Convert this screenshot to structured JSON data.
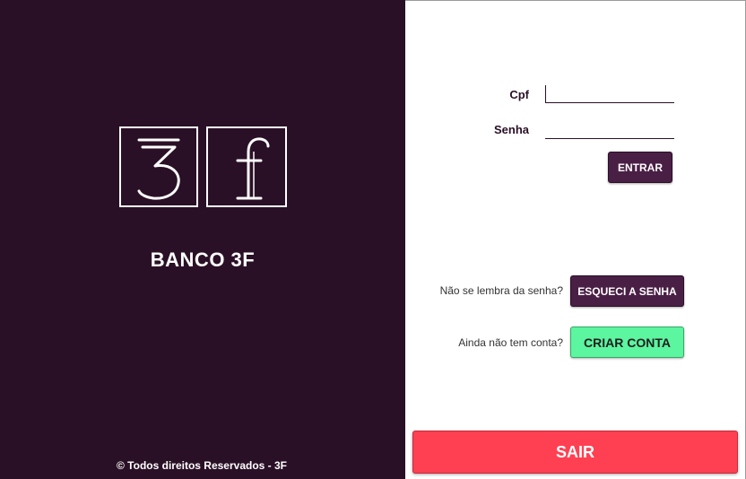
{
  "brand": {
    "logo_label": "3f",
    "name": "BANCO 3F",
    "footer": "© Todos direitos Reservados - 3F"
  },
  "login": {
    "cpf_label": "Cpf",
    "cpf_value": "",
    "senha_label": "Senha",
    "senha_value": "",
    "entrar_label": "ENTRAR"
  },
  "recovery": {
    "prompt": "Não se lembra da senha?",
    "button_label": "ESQUECI A SENHA"
  },
  "signup": {
    "prompt": "Ainda não tem conta?",
    "button_label": "CRIAR CONTA"
  },
  "exit": {
    "button_label": "SAIR"
  },
  "colors": {
    "panel": "#2a1026",
    "button_dark": "#4a1f45",
    "button_green": "#5cf5a0",
    "button_red": "#ff4052"
  }
}
